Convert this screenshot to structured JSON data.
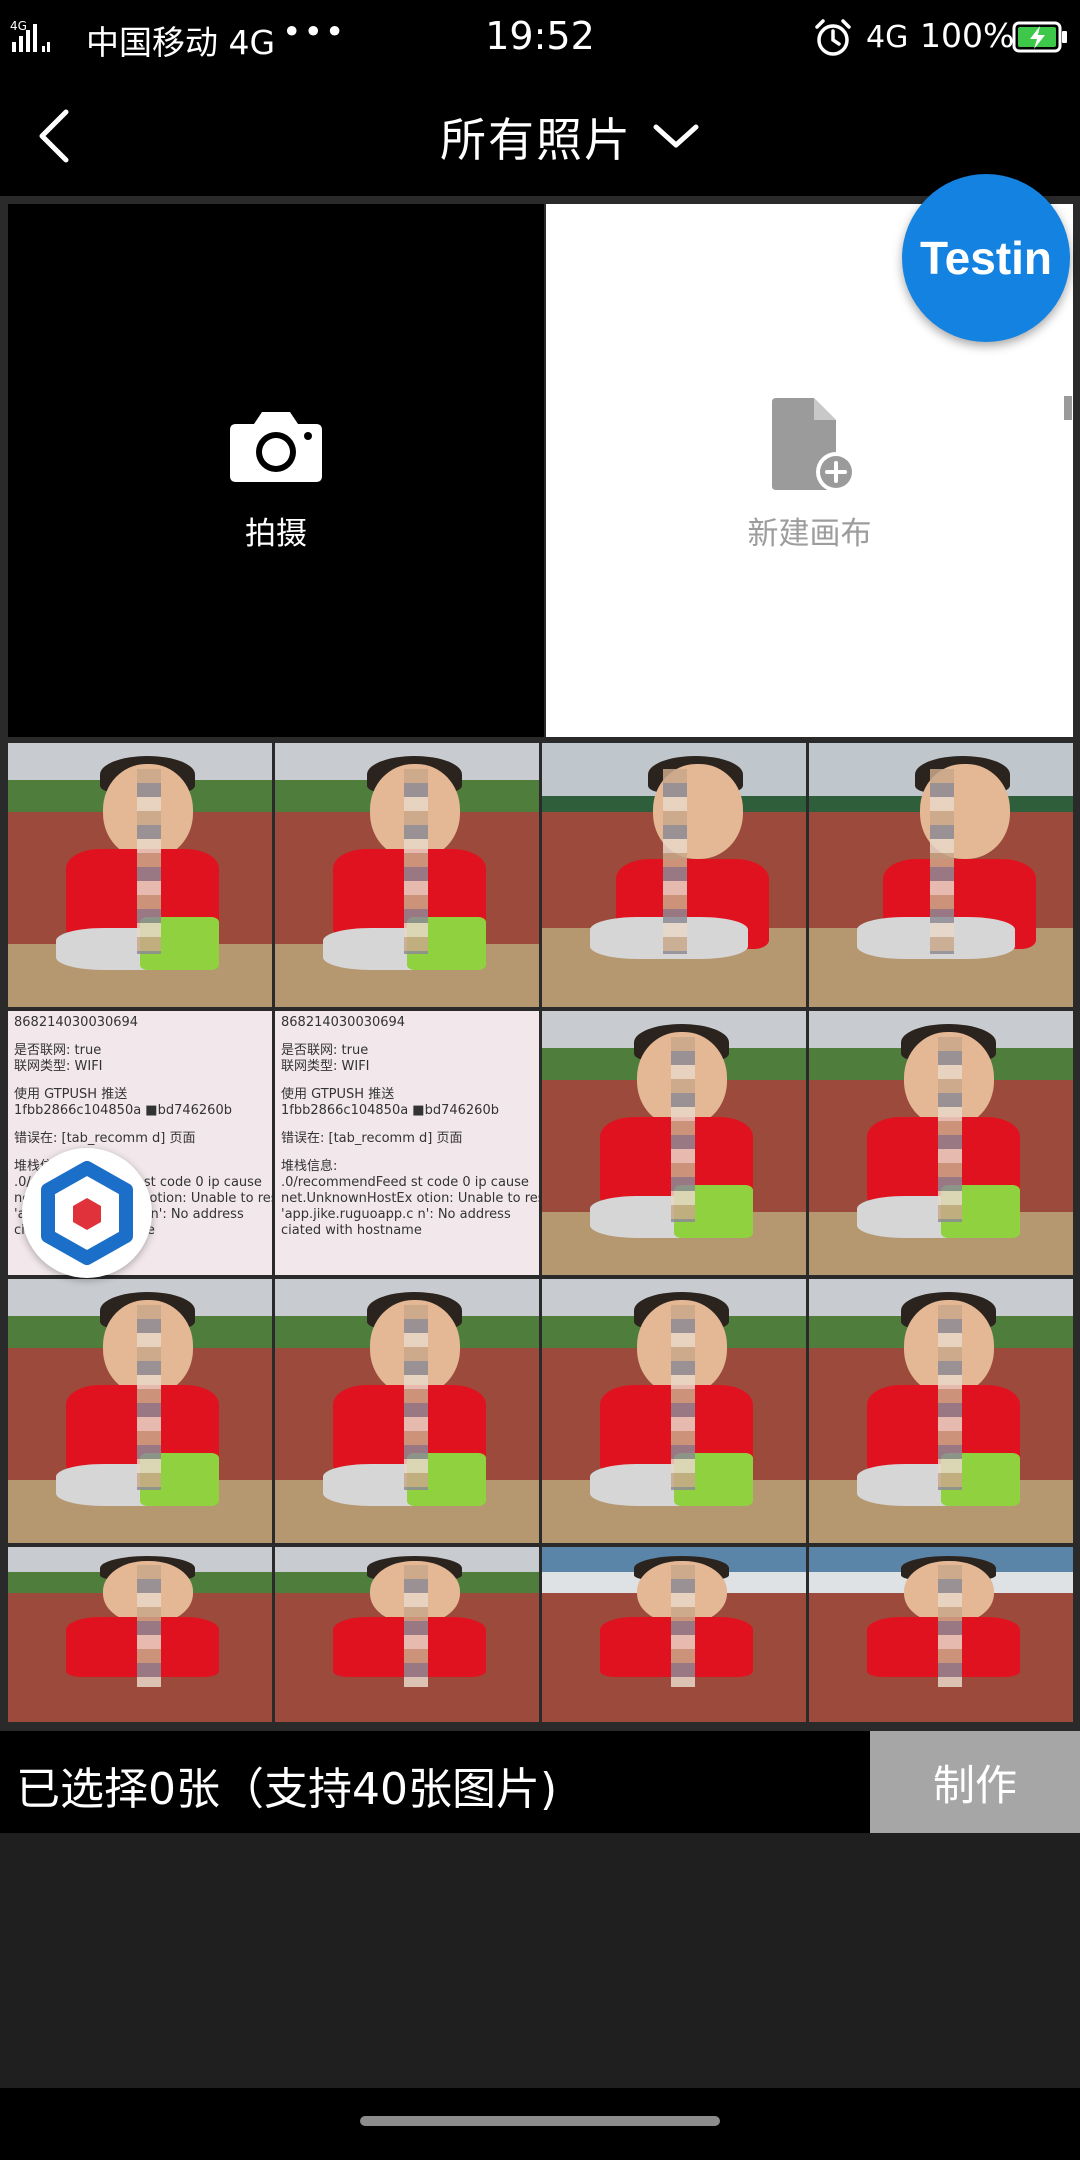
{
  "status_bar": {
    "carrier": "中国移动 4G",
    "more": "•••",
    "time": "19:52",
    "network": "4G",
    "battery": "100%",
    "signal_icon": "signal-icon",
    "alarm_icon": "alarm-icon",
    "battery_icon": "battery-charging-icon"
  },
  "header": {
    "title": "所有照片",
    "back_icon": "chevron-left-icon",
    "dropdown_icon": "chevron-down-icon"
  },
  "tiles": {
    "camera_label": "拍摄",
    "canvas_label": "新建画布"
  },
  "floating": {
    "testin_label": "Testin"
  },
  "log_screenshot": {
    "left": [
      "868214030030694",
      "",
      "是否联网: true",
      "联网类型: WIFI",
      "",
      "使用 GTPUSH 推送",
      "1fbb2866c104850a  ■bd746260b",
      "",
      "错误在: [tab_recomm  d] 页面",
      "",
      "堆栈信息:",
      ".0/recommendFeed  st code 0 ip  cause",
      "net.UnknownHostEx  otion: Unable to reso",
      "'app.jike.ruguoapp.c  n': No address",
      "ciated with hostname"
    ],
    "right": [
      "868214030030694",
      "",
      "是否联网: true",
      "联网类型: WIFI",
      "",
      "使用 GTPUSH 推送",
      "1fbb2866c104850a  ■bd746260b",
      "",
      "错误在: [tab_recomm  d] 页面",
      "",
      "堆栈信息:",
      ".0/recommendFeed  st code 0 ip  cause",
      "net.UnknownHostEx  otion: Unable to reso",
      "'app.jike.ruguoapp.c  n': No address",
      "ciated with hostname"
    ]
  },
  "bottom_bar": {
    "selection_text": "已选择0张（支持40张图片)",
    "make_label": "制作"
  },
  "colors": {
    "background": "#000000",
    "testin_blue": "#1482e0",
    "make_button": "#a6a6a6",
    "empty_area": "#1f1f1f"
  }
}
